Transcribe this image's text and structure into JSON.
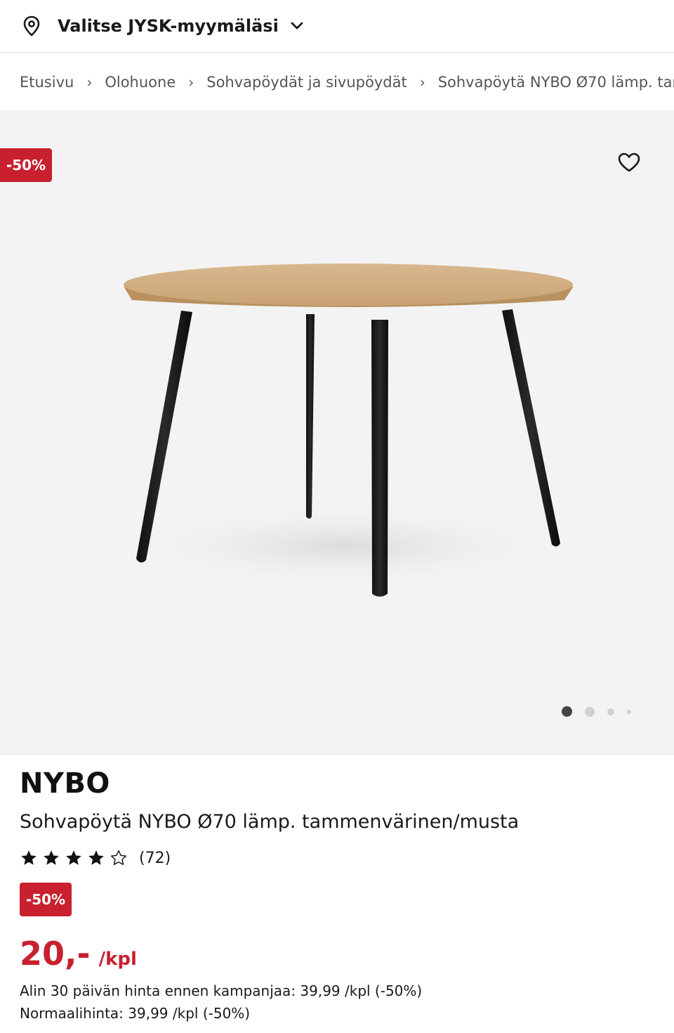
{
  "store_bar": {
    "label": "Valitse JYSK-myymäläsi",
    "icon": "location-pin-icon",
    "dropdown_icon": "chevron-down-icon"
  },
  "breadcrumb": {
    "items": [
      "Etusivu",
      "Olohuone",
      "Sohvapöydät ja sivupöydät",
      "Sohvapöytä NYBO Ø70 lämp. tar"
    ],
    "separator": "›"
  },
  "gallery": {
    "discount_badge": "-50%",
    "favorite_icon": "heart-outline-icon",
    "image_count": 4,
    "active_index": 0
  },
  "product": {
    "brand": "NYBO",
    "name": "Sohvapöytä NYBO Ø70 lämp. tammenvärinen/musta",
    "rating_value": 4,
    "rating_max": 5,
    "review_count": "(72)",
    "discount_badge": "-50%",
    "price": "20,-",
    "price_unit": "/kpl",
    "lowest_price_line": "Alin 30 päivän hinta ennen kampanjaa: 39,99 /kpl (-50%)",
    "normal_price_line": "Normaalihinta: 39,99 /kpl (-50%)"
  },
  "colors": {
    "sale_red": "#c8202f",
    "gallery_bg": "#f3f3f3",
    "text": "#1a1a1a"
  }
}
